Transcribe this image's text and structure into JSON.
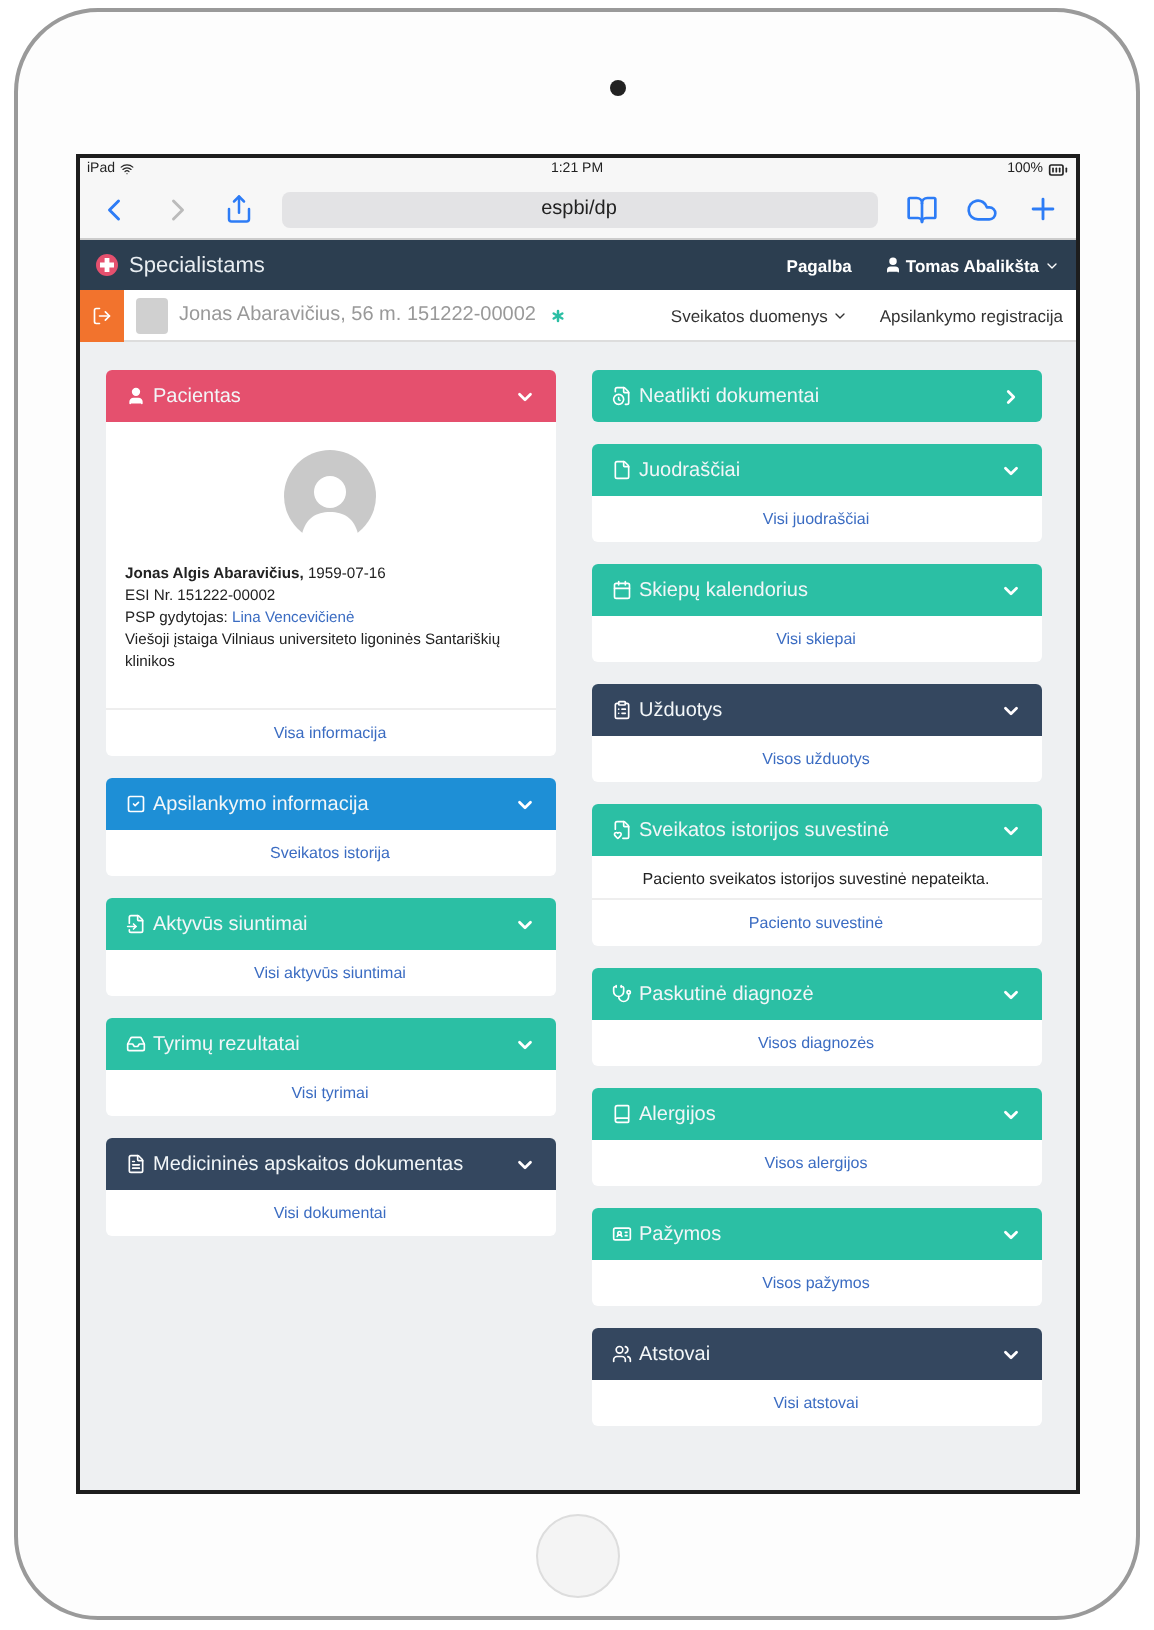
{
  "status_bar": {
    "device": "iPad",
    "time": "1:21 PM",
    "battery": "100%"
  },
  "browser": {
    "url": "espbi/dp"
  },
  "navbar": {
    "brand": "Specialistams",
    "help": "Pagalba",
    "user": "Tomas Abalikšta"
  },
  "patient_bar": {
    "patient": "Jonas Abaravičius, 56 m. 151222-00002",
    "menu": "Sveikatos duomenys",
    "registration": "Apsilankymo registracija"
  },
  "patient_card": {
    "title": "Pacientas",
    "color": "#e5506e",
    "expanded": true,
    "name_line": "**Jonas Algis Abaravičius,** 1959-07-16",
    "esi": "ESI Nr. 151222-00002",
    "doctor_label": "PSP gydytojas:",
    "doctor": "Lina Vencevičienė",
    "institution": "Viešoji įstaiga Vilniaus universiteto ligoninės Santariškių klinikos",
    "link": "Visa informacija"
  },
  "left_panels": [
    {
      "title": "Apsilankymo informacija",
      "color": "#1e8fd6",
      "expanded": true,
      "link": "Sveikatos istorija"
    },
    {
      "title": "Aktyvūs siuntimai",
      "color": "#2bbfa4",
      "expanded": true,
      "link": "Visi aktyvūs siuntimai"
    },
    {
      "title": "Tyrimų rezultatai",
      "color": "#2bbfa4",
      "expanded": true,
      "link": "Visi tyrimai"
    },
    {
      "title": "Medicininės apskaitos dokumentas",
      "color": "#34475f",
      "expanded": true,
      "link": "Visi dokumentai"
    }
  ],
  "right_panels": [
    {
      "title": "Neatlikti dokumentai",
      "color": "#2bbfa4",
      "expanded": false
    },
    {
      "title": "Juodraščiai",
      "color": "#2bbfa4",
      "expanded": true,
      "link": "Visi juodraščiai"
    },
    {
      "title": "Skiepų kalendorius",
      "color": "#2bbfa4",
      "expanded": true,
      "link": "Visi skiepai"
    },
    {
      "title": "Užduotys",
      "color": "#34475f",
      "expanded": true,
      "link": "Visos užduotys"
    },
    {
      "title": "Sveikatos istorijos suvestinė",
      "color": "#2bbfa4",
      "expanded": true,
      "text": "Paciento sveikatos istorijos suvestinė nepateikta.",
      "link": "Paciento suvestinė"
    },
    {
      "title": "Paskutinė diagnozė",
      "color": "#2bbfa4",
      "expanded": true,
      "link": "Visos diagnozės"
    },
    {
      "title": "Alergijos",
      "color": "#2bbfa4",
      "expanded": true,
      "link": "Visos alergijos"
    },
    {
      "title": "Pažymos",
      "color": "#2bbfa4",
      "expanded": true,
      "link": "Visos pažymos"
    },
    {
      "title": "Atstovai",
      "color": "#34475f",
      "expanded": true,
      "link": "Visi atstovai"
    }
  ]
}
